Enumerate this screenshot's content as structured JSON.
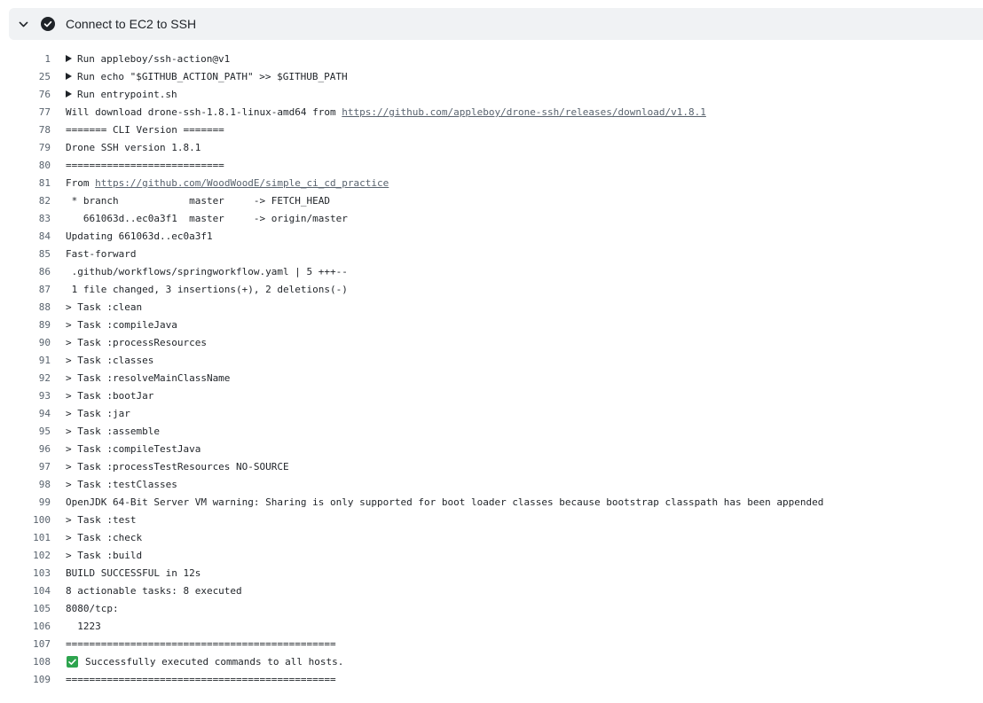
{
  "step": {
    "title": "Connect to EC2 to SSH",
    "expanded": true,
    "status": "success",
    "icons": {
      "collapse": "chevron-down-icon",
      "status": "check-circle-icon"
    },
    "colors": {
      "header_bg": "#f0f2f4",
      "status_icon": "#1f2328",
      "success_emoji": "#2da44e"
    }
  },
  "log": {
    "lines": [
      {
        "num": "1",
        "text": "Run appleboy/ssh-action@v1",
        "group": true
      },
      {
        "num": "25",
        "text": "Run echo \"$GITHUB_ACTION_PATH\" >> $GITHUB_PATH",
        "group": true
      },
      {
        "num": "76",
        "text": "Run entrypoint.sh",
        "group": true
      },
      {
        "num": "77",
        "text": "Will download drone-ssh-1.8.1-linux-amd64 from ",
        "link": "https://github.com/appleboy/drone-ssh/releases/download/v1.8.1"
      },
      {
        "num": "78",
        "text": "======= CLI Version ======="
      },
      {
        "num": "79",
        "text": "Drone SSH version 1.8.1"
      },
      {
        "num": "80",
        "text": "==========================="
      },
      {
        "num": "81",
        "text": "From ",
        "link": "https://github.com/WoodWoodE/simple_ci_cd_practice"
      },
      {
        "num": "82",
        "text": " * branch            master     -> FETCH_HEAD"
      },
      {
        "num": "83",
        "text": "   661063d..ec0a3f1  master     -> origin/master"
      },
      {
        "num": "84",
        "text": "Updating 661063d..ec0a3f1"
      },
      {
        "num": "85",
        "text": "Fast-forward"
      },
      {
        "num": "86",
        "text": " .github/workflows/springworkflow.yaml | 5 +++--"
      },
      {
        "num": "87",
        "text": " 1 file changed, 3 insertions(+), 2 deletions(-)"
      },
      {
        "num": "88",
        "text": "> Task :clean"
      },
      {
        "num": "89",
        "text": "> Task :compileJava"
      },
      {
        "num": "90",
        "text": "> Task :processResources"
      },
      {
        "num": "91",
        "text": "> Task :classes"
      },
      {
        "num": "92",
        "text": "> Task :resolveMainClassName"
      },
      {
        "num": "93",
        "text": "> Task :bootJar"
      },
      {
        "num": "94",
        "text": "> Task :jar"
      },
      {
        "num": "95",
        "text": "> Task :assemble"
      },
      {
        "num": "96",
        "text": "> Task :compileTestJava"
      },
      {
        "num": "97",
        "text": "> Task :processTestResources NO-SOURCE"
      },
      {
        "num": "98",
        "text": "> Task :testClasses"
      },
      {
        "num": "99",
        "text": "OpenJDK 64-Bit Server VM warning: Sharing is only supported for boot loader classes because bootstrap classpath has been appended"
      },
      {
        "num": "100",
        "text": "> Task :test"
      },
      {
        "num": "101",
        "text": "> Task :check"
      },
      {
        "num": "102",
        "text": "> Task :build"
      },
      {
        "num": "103",
        "text": "BUILD SUCCESSFUL in 12s"
      },
      {
        "num": "104",
        "text": "8 actionable tasks: 8 executed"
      },
      {
        "num": "105",
        "text": "8080/tcp:"
      },
      {
        "num": "106",
        "text": "  1223"
      },
      {
        "num": "107",
        "text": "=============================================="
      },
      {
        "num": "108",
        "text": "Successfully executed commands to all hosts.",
        "emoji": "check-mark-button-icon"
      },
      {
        "num": "109",
        "text": "=============================================="
      }
    ]
  }
}
